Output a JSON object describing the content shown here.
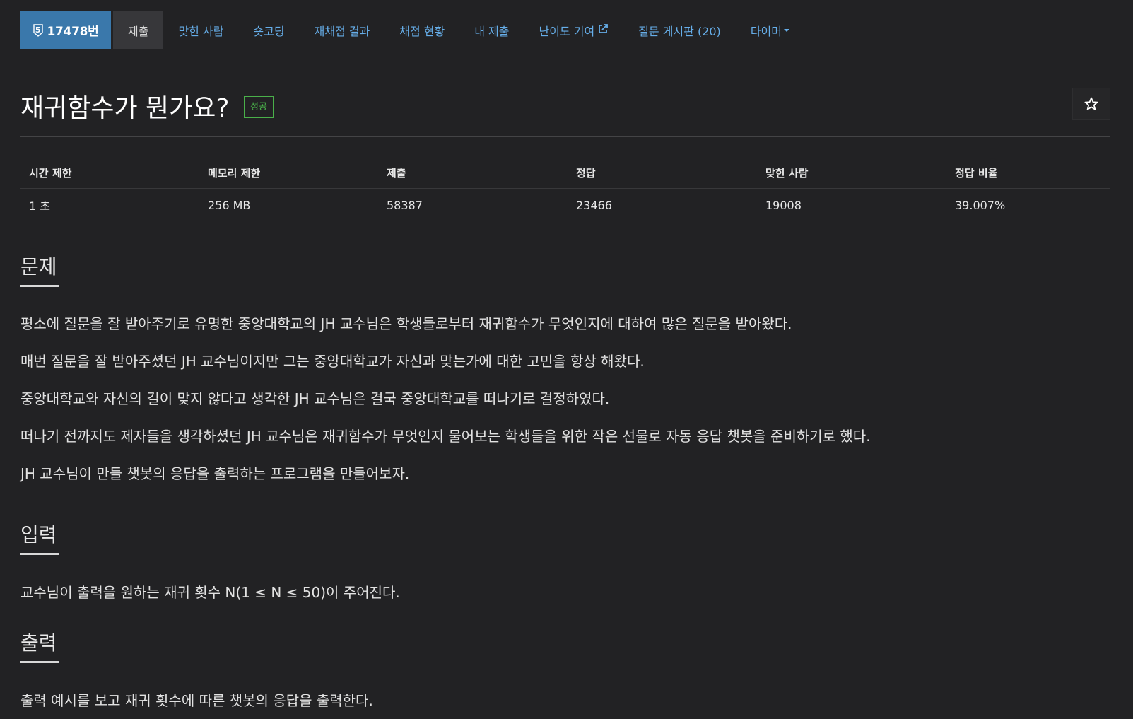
{
  "nav": {
    "problem_badge": "17478번",
    "tier_glyph": "5",
    "items": [
      {
        "label": "제출",
        "active": true
      },
      {
        "label": "맞힌 사람"
      },
      {
        "label": "숏코딩"
      },
      {
        "label": "재채점 결과"
      },
      {
        "label": "채점 현황"
      },
      {
        "label": "내 제출"
      },
      {
        "label": "난이도 기여",
        "icon": "external-link-icon"
      },
      {
        "label": "질문 게시판 (20)"
      },
      {
        "label": "타이머",
        "icon": "caret-down-icon"
      }
    ]
  },
  "problem": {
    "title": "재귀함수가 뭔가요?",
    "result_label": "성공",
    "star_icon": "star-icon"
  },
  "info_table": {
    "headers": [
      "시간 제한",
      "메모리 제한",
      "제출",
      "정답",
      "맞힌 사람",
      "정답 비율"
    ],
    "values": [
      "1 초",
      "256 MB",
      "58387",
      "23466",
      "19008",
      "39.007%"
    ]
  },
  "sections": {
    "description": {
      "heading": "문제",
      "paragraphs": [
        "평소에 질문을 잘 받아주기로 유명한 중앙대학교의 JH 교수님은 학생들로부터 재귀함수가 무엇인지에 대하여 많은 질문을 받아왔다.",
        "매번 질문을 잘 받아주셨던 JH 교수님이지만 그는 중앙대학교가 자신과 맞는가에 대한 고민을 항상 해왔다.",
        "중앙대학교와 자신의 길이 맞지 않다고 생각한 JH 교수님은 결국 중앙대학교를 떠나기로 결정하였다.",
        "떠나기 전까지도 제자들을 생각하셨던 JH 교수님은 재귀함수가 무엇인지 물어보는 학생들을 위한 작은 선물로 자동 응답 챗봇을 준비하기로 했다.",
        "JH 교수님이 만들 챗봇의 응답을 출력하는 프로그램을 만들어보자."
      ]
    },
    "input": {
      "heading": "입력",
      "paragraphs": [
        "교수님이 출력을 원하는 재귀 횟수 N(1 ≤ N ≤ 50)이 주어진다."
      ]
    },
    "output": {
      "heading": "출력",
      "paragraphs": [
        "출력 예시를 보고 재귀 횟수에 따른 챗봇의 응답을 출력한다."
      ]
    }
  },
  "colors": {
    "background": "#222224",
    "link": "#66aee9",
    "badge": "#3a78ab",
    "success": "#4ab04a"
  }
}
